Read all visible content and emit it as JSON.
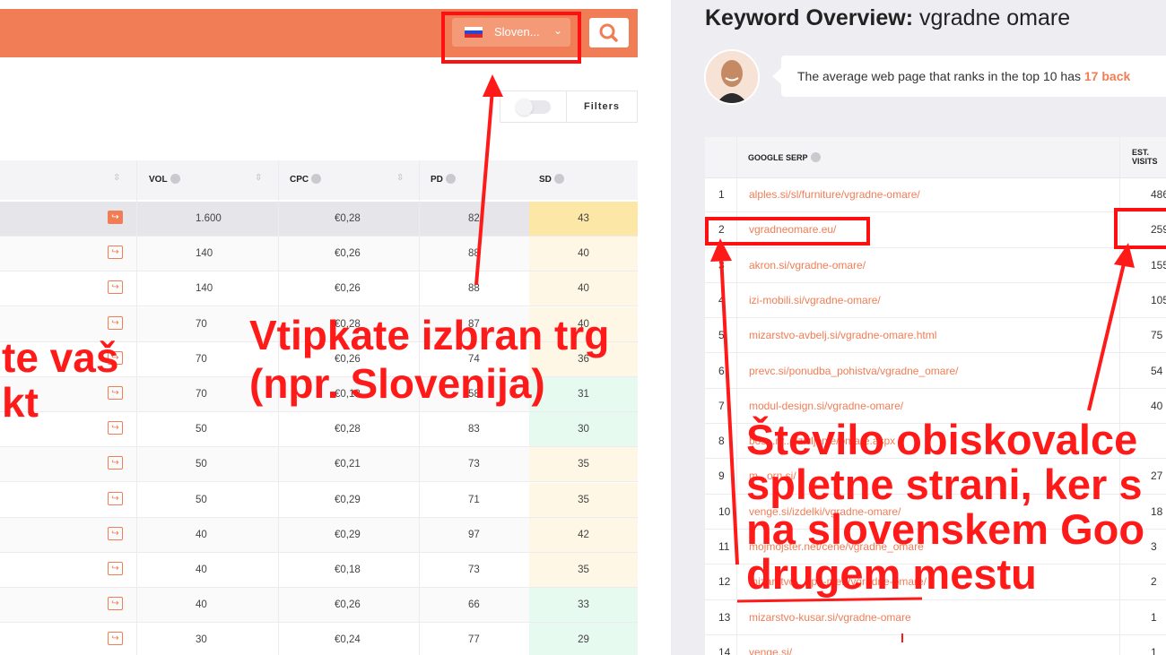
{
  "left_panel": {
    "country_selector": {
      "label": "Sloven...",
      "flag_colors": [
        "#ffffff",
        "#2a49c8",
        "#e0262b"
      ]
    },
    "filters_label": "Filters",
    "table": {
      "headers": {
        "vol": "VOL",
        "cpc": "CPC",
        "pd": "PD",
        "sd": "SD"
      },
      "rows": [
        {
          "vol": "1.600",
          "cpc": "€0,28",
          "pd": "82",
          "sd": "43"
        },
        {
          "vol": "140",
          "cpc": "€0,26",
          "pd": "88",
          "sd": "40"
        },
        {
          "vol": "140",
          "cpc": "€0,26",
          "pd": "88",
          "sd": "40"
        },
        {
          "vol": "70",
          "cpc": "€0,28",
          "pd": "87",
          "sd": "40"
        },
        {
          "vol": "70",
          "cpc": "€0,26",
          "pd": "74",
          "sd": "36"
        },
        {
          "vol": "70",
          "cpc": "€0,18",
          "pd": "58",
          "sd": "31"
        },
        {
          "vol": "50",
          "cpc": "€0,28",
          "pd": "83",
          "sd": "30"
        },
        {
          "vol": "50",
          "cpc": "€0,21",
          "pd": "73",
          "sd": "35"
        },
        {
          "vol": "50",
          "cpc": "€0,29",
          "pd": "71",
          "sd": "35"
        },
        {
          "vol": "40",
          "cpc": "€0,29",
          "pd": "97",
          "sd": "42"
        },
        {
          "vol": "40",
          "cpc": "€0,18",
          "pd": "73",
          "sd": "35"
        },
        {
          "vol": "40",
          "cpc": "€0,26",
          "pd": "66",
          "sd": "33"
        },
        {
          "vol": "30",
          "cpc": "€0,24",
          "pd": "77",
          "sd": "29"
        }
      ]
    }
  },
  "right_panel": {
    "title_bold": "Keyword Overview:",
    "title_keyword": "vgradne omare",
    "tip_text": "The average web page that ranks in the top 10 has",
    "tip_highlight": "17 back",
    "serp": {
      "header_serp": "GOOGLE SERP",
      "header_visits_line1": "EST.",
      "header_visits_line2": "VISITS",
      "rows": [
        {
          "n": "1",
          "url": "alples.si/sl/furniture/vgradne-omare/",
          "visits": "486"
        },
        {
          "n": "2",
          "url": "vgradneomare.eu/",
          "visits": "259"
        },
        {
          "n": "3",
          "url": "akron.si/vgradne-omare/",
          "visits": "155"
        },
        {
          "n": "4",
          "url": "izi-mobili.si/vgradne-omare/",
          "visits": "105"
        },
        {
          "n": "5",
          "url": "mizarstvo-avbelj.si/vgradne-omare.html",
          "visits": "75"
        },
        {
          "n": "6",
          "url": "prevc.si/ponudba_pohistva/vgradne_omare/",
          "visits": "54"
        },
        {
          "n": "7",
          "url": "modul-design.si/vgradne-omare/",
          "visits": "40"
        },
        {
          "n": "8",
          "url": "bos...ry...l/zivljenje/omare.aspx",
          "visits": ""
        },
        {
          "n": "9",
          "url": "m...orn.si/",
          "visits": "27"
        },
        {
          "n": "10",
          "url": "venge.si/izdelki/vgradne-omare/",
          "visits": "18"
        },
        {
          "n": "11",
          "url": "mojmojster.net/cene/vgradne_omare",
          "visits": "3"
        },
        {
          "n": "12",
          "url": "mizarstvo-...-po-meri/vgradne-omare/",
          "visits": "2"
        },
        {
          "n": "13",
          "url": "mizarstvo-kusar.si/vgradne-omare",
          "visits": "1"
        },
        {
          "n": "14",
          "url": "venge.si/",
          "visits": "1"
        }
      ]
    }
  },
  "annotations": {
    "market_line1": "Vtipkate izbran trg",
    "market_line2": "(npr. Slovenija)",
    "product_line1": "te vaš",
    "product_line2": "kt",
    "visitors_line1": "Število obiskovalce",
    "visitors_line2": "spletne strani, ker s",
    "visitors_line3": "na slovenskem Goo",
    "visitors_line4": "drugem mestu",
    "color": "#ff1a1a"
  },
  "colors": {
    "brand_orange": "#f07d55",
    "sd_high": "#fde7a6",
    "sd_mid": "#fff7e6",
    "sd_low": "#e6faef"
  }
}
